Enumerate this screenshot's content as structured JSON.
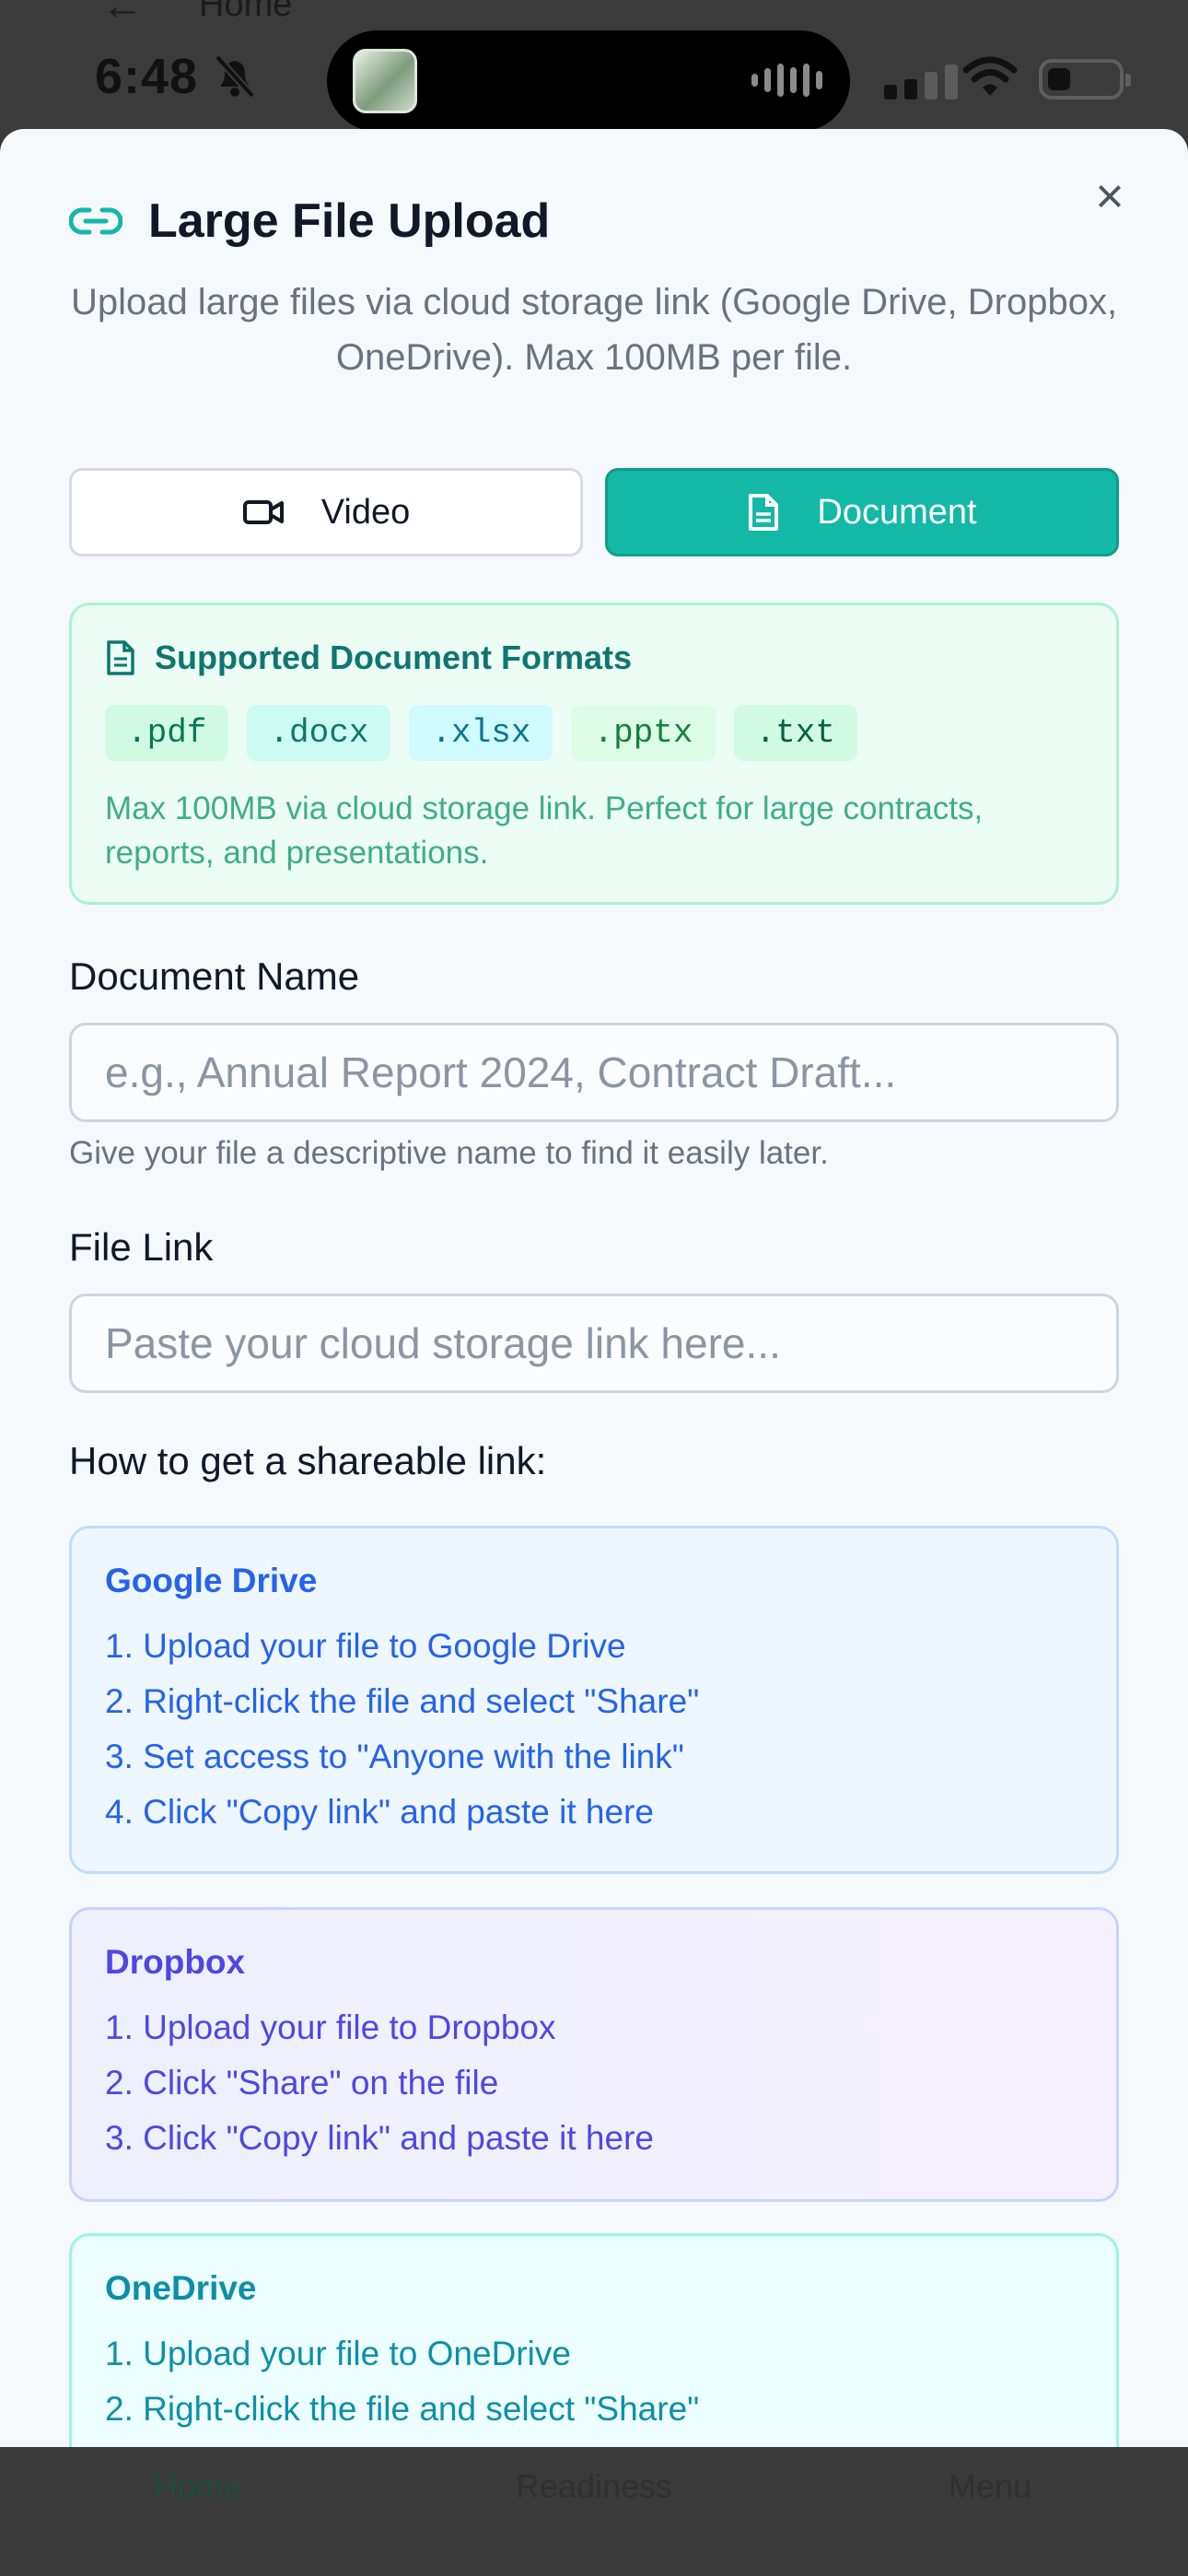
{
  "background": {
    "back_label": "Home"
  },
  "status_bar": {
    "time": "6:48",
    "icons": [
      "bell-off-icon",
      "app-thumbnail-icon",
      "audio-wave-icon",
      "cellular-signal-icon",
      "wifi-icon",
      "battery-icon"
    ]
  },
  "modal": {
    "title": "Large File Upload",
    "subtitle": "Upload large files via cloud storage link (Google Drive, Dropbox, OneDrive). Max 100MB per file.",
    "close_icon": "close-icon",
    "type_options": [
      {
        "label": "Video",
        "icon": "video-camera-icon",
        "selected": false
      },
      {
        "label": "Document",
        "icon": "document-icon",
        "selected": true
      }
    ],
    "formats": {
      "title": "Supported Document Formats",
      "chips": [
        ".pdf",
        ".docx",
        ".xlsx",
        ".pptx",
        ".txt"
      ],
      "note": "Max 100MB via cloud storage link. Perfect for large contracts, reports, and presentations."
    },
    "document_name": {
      "label": "Document Name",
      "placeholder": "e.g., Annual Report 2024, Contract Draft...",
      "value": "",
      "hint": "Give your file a descriptive name to find it easily later."
    },
    "file_link": {
      "label": "File Link",
      "placeholder": "Paste your cloud storage link here...",
      "value": ""
    },
    "howto_title": "How to get a shareable link:",
    "guides": {
      "google": {
        "title": "Google Drive",
        "steps": [
          "1. Upload your file to Google Drive",
          "2. Right-click the file and select \"Share\"",
          "3. Set access to \"Anyone with the link\"",
          "4. Click \"Copy link\" and paste it here"
        ]
      },
      "dropbox": {
        "title": "Dropbox",
        "steps": [
          "1. Upload your file to Dropbox",
          "2. Click \"Share\" on the file",
          "3. Click \"Copy link\" and paste it here"
        ]
      },
      "onedrive": {
        "title": "OneDrive",
        "steps": [
          "1. Upload your file to OneDrive",
          "2. Right-click the file and select \"Share\""
        ]
      }
    }
  },
  "tab_bar": {
    "tabs": [
      "Home",
      "Readiness",
      "Menu"
    ]
  },
  "colors": {
    "accent": "#14b8a6",
    "chip_pdf": "#d1fae5",
    "chip_docx": "#ccfbf1",
    "chip_xlsx": "#cffafe",
    "chip_pptx": "#dcfce7",
    "chip_txt": "#d1fae5"
  }
}
